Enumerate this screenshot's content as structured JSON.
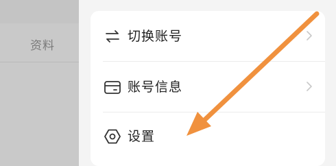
{
  "background": {
    "profile_label": "资料"
  },
  "menu": {
    "items": [
      {
        "label": "切换账号",
        "icon": "switch-arrows-icon",
        "has_chevron": true
      },
      {
        "label": "账号信息",
        "icon": "card-icon",
        "has_chevron": true
      },
      {
        "label": "设置",
        "icon": "hexagon-settings-icon",
        "has_chevron": false
      }
    ]
  },
  "colors": {
    "annotation_arrow": "#f0913e",
    "card_bg": "#ffffff",
    "dimmed_bg": "#c9c9c9"
  },
  "icons": [
    "switch-arrows-icon",
    "card-icon",
    "hexagon-settings-icon",
    "chevron-right-icon"
  ]
}
